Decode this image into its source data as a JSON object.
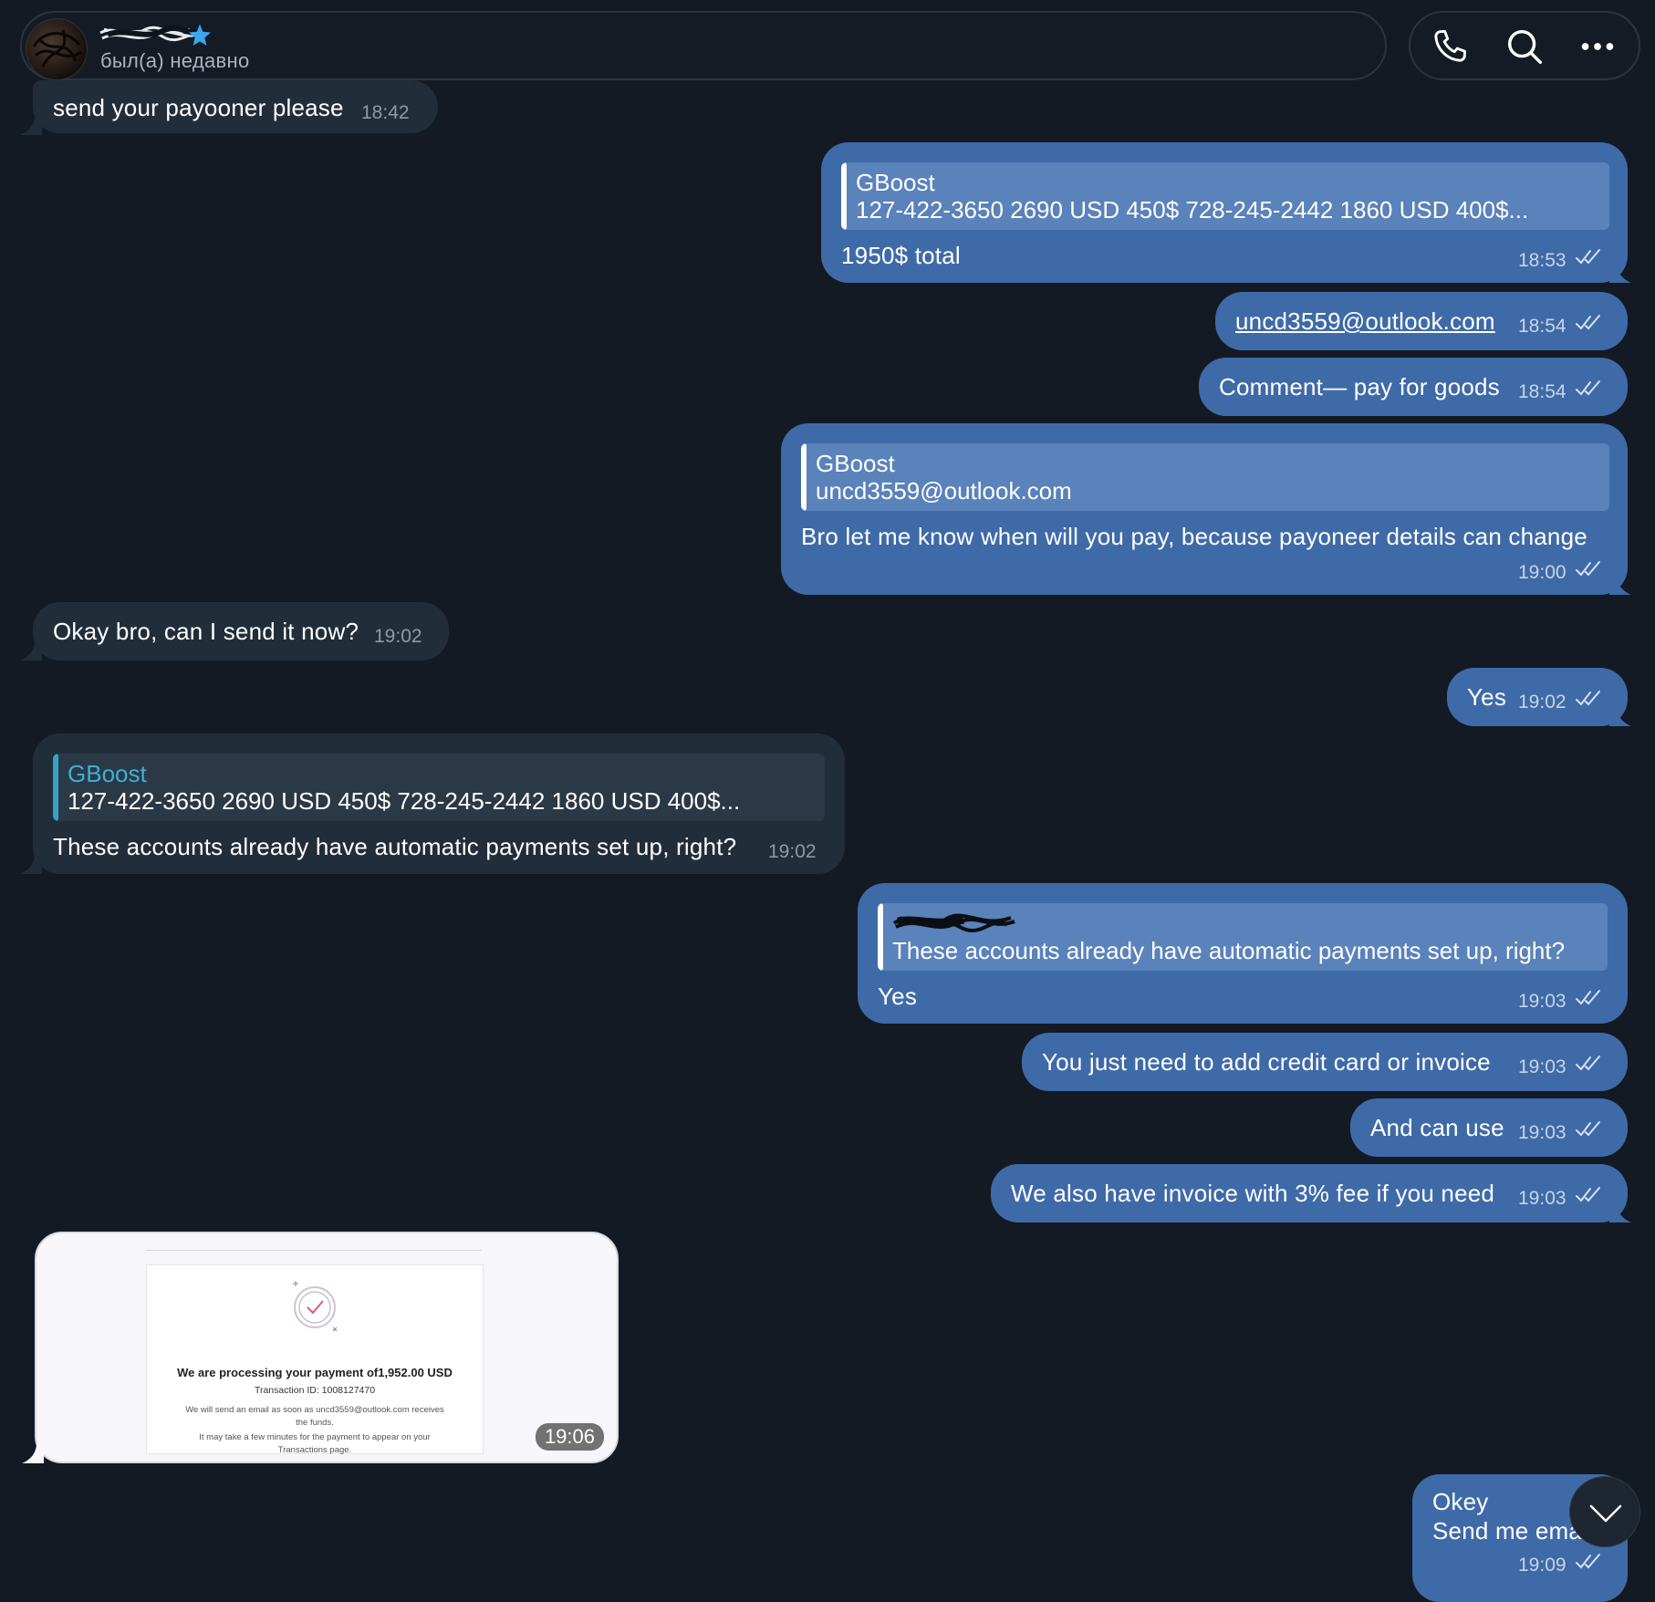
{
  "header": {
    "status": "был(а) недавно"
  },
  "messages": {
    "m1": {
      "text": "send your payooner please",
      "time": "18:42"
    },
    "m2": {
      "reply_title": "GBoost",
      "reply_body": "127-422-3650 2690 USD  450$ 728-245-2442 1860 USD  400$...",
      "text": "1950$ total",
      "time": "18:53"
    },
    "m3": {
      "text": "uncd3559@outlook.com",
      "time": "18:54"
    },
    "m4": {
      "text": "Comment— pay for goods",
      "time": "18:54"
    },
    "m5": {
      "reply_title": "GBoost",
      "reply_body": "uncd3559@outlook.com",
      "text": "Bro let me know when will you pay, because payoneer details can change",
      "time": "19:00"
    },
    "m6": {
      "text": "Okay bro, can I send it now?",
      "time": "19:02"
    },
    "m7": {
      "text": "Yes",
      "time": "19:02"
    },
    "m8": {
      "reply_title": "GBoost",
      "reply_body": "127-422-3650 2690 USD  450$ 728-245-2442 1860 USD  400$...",
      "text": "These accounts already have automatic payments set up, right?",
      "time": "19:02"
    },
    "m9": {
      "reply_body": "These accounts already have automatic payments set up, right?",
      "text": "Yes",
      "time": "19:03"
    },
    "m10": {
      "text": "You just need to add credit card or invoice",
      "time": "19:03"
    },
    "m11": {
      "text": "And can use",
      "time": "19:03"
    },
    "m12": {
      "text": "We also have invoice with 3% fee if you need",
      "time": "19:03"
    },
    "m13": {
      "time": "19:06",
      "image_title": "We are processing your payment of1,952.00 USD",
      "image_tx": "Transaction ID: 1008127470",
      "image_line1": "We will send an email as soon as uncd3559@outlook.com receives",
      "image_line2": "the funds.",
      "image_line3": "It may take a few minutes for the payment to appear on your",
      "image_line4": "Transactions page."
    },
    "m14": {
      "line1": "Okey",
      "line2": "Send me ema",
      "time": "19:09"
    }
  },
  "colors": {
    "background": "#131a23",
    "outgoing_bubble": "#3f6aa8",
    "incoming_bubble": "#222d3a",
    "reply_accent_incoming": "#3fb0d3"
  },
  "icons": [
    "phone-icon",
    "search-icon",
    "more-icon",
    "star-icon",
    "double-check-icon",
    "chevron-down-icon"
  ]
}
